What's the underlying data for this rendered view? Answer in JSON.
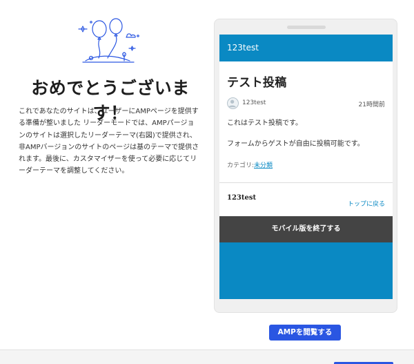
{
  "main": {
    "title": "おめでとうございます！",
    "description": "これであなたのサイトは、ユーザーにAMPページを提供する準備が整いました リーダーモードでは、AMPパージョンのサイトは選択したリーダーテーマ(右図)で提供され、非AMPバージョンのサイトのページは基のテーマで提供されます。最後に、カスタマイザーを使って必要に応じてリーダーテーマを調整してください。"
  },
  "preview": {
    "site_name": "123test",
    "post": {
      "title": "テスト投稿",
      "author": "123test",
      "time": "21時間前",
      "paragraphs": [
        "これはテスト投稿です。",
        "フォームからゲストが自由に投稿可能です。"
      ],
      "category_label": "カテゴリ:",
      "category_link": "未分類"
    },
    "footer": {
      "site_name": "123test",
      "back_to_top": "トップに戻る"
    },
    "exit_mobile_label": "モバイル版を終了する"
  },
  "actions": {
    "view_amp_label": "AMPを閲覧する"
  },
  "colors": {
    "accent_blue": "#0a89c3",
    "button_blue": "#2a56e2",
    "dark_bar": "#444444"
  },
  "icons": {
    "illustration": "balloons-celebration-icon",
    "avatar": "user-avatar-icon"
  }
}
